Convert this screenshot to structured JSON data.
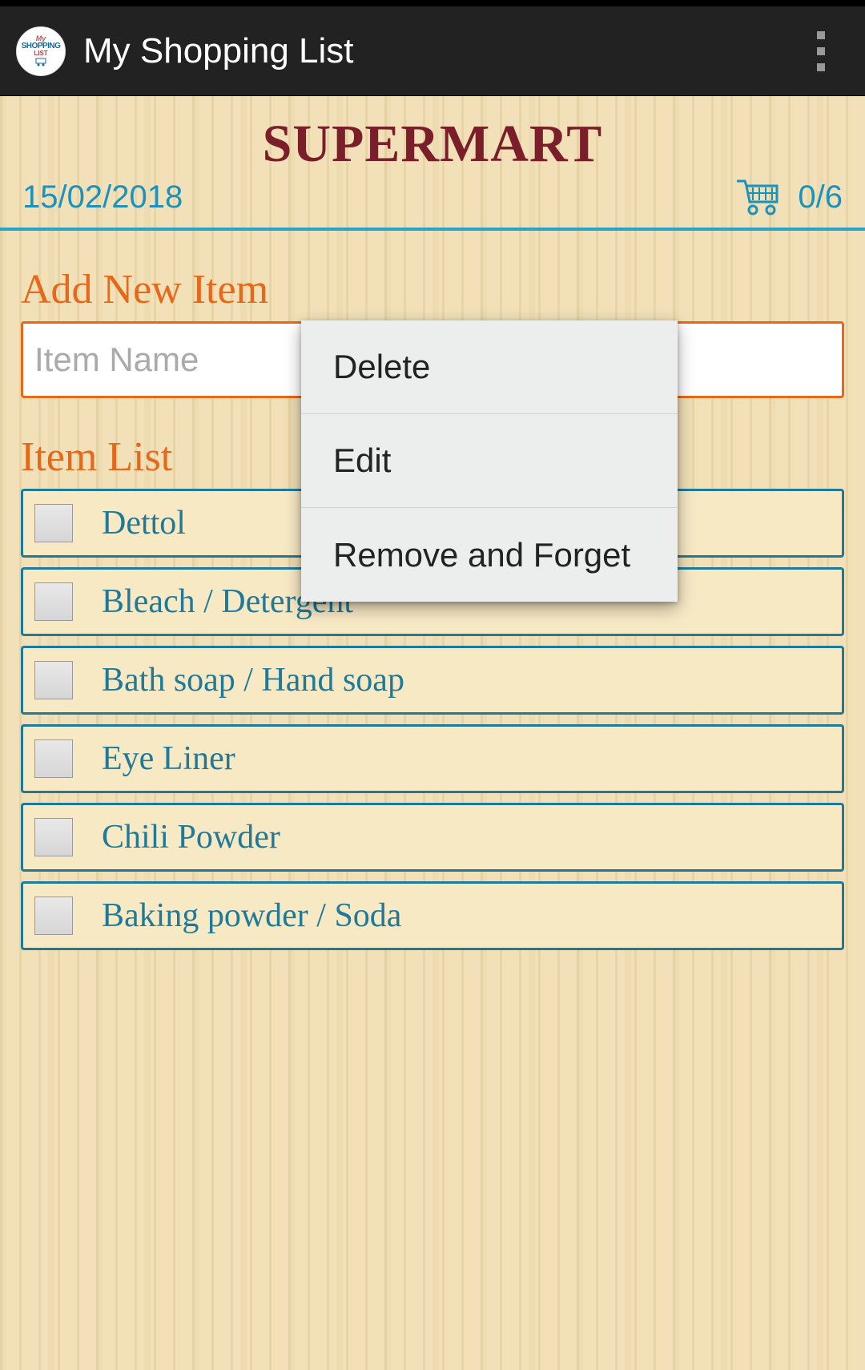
{
  "app": {
    "title": "My Shopping List",
    "logo_l1": "My",
    "logo_l2": "SHOPPING",
    "logo_l3": "LIST"
  },
  "header": {
    "store": "SUPERMART",
    "date": "15/02/2018",
    "count": "0/6"
  },
  "sections": {
    "add_title": "Add New Item",
    "list_title": "Item List"
  },
  "input": {
    "placeholder": "Item Name",
    "value": ""
  },
  "items": [
    {
      "label": "Dettol"
    },
    {
      "label": "Bleach / Detergent"
    },
    {
      "label": "Bath soap / Hand soap"
    },
    {
      "label": "Eye Liner"
    },
    {
      "label": "Chili Powder"
    },
    {
      "label": "Baking powder / Soda"
    }
  ],
  "menu": {
    "delete": "Delete",
    "edit": "Edit",
    "remove": "Remove and Forget"
  }
}
